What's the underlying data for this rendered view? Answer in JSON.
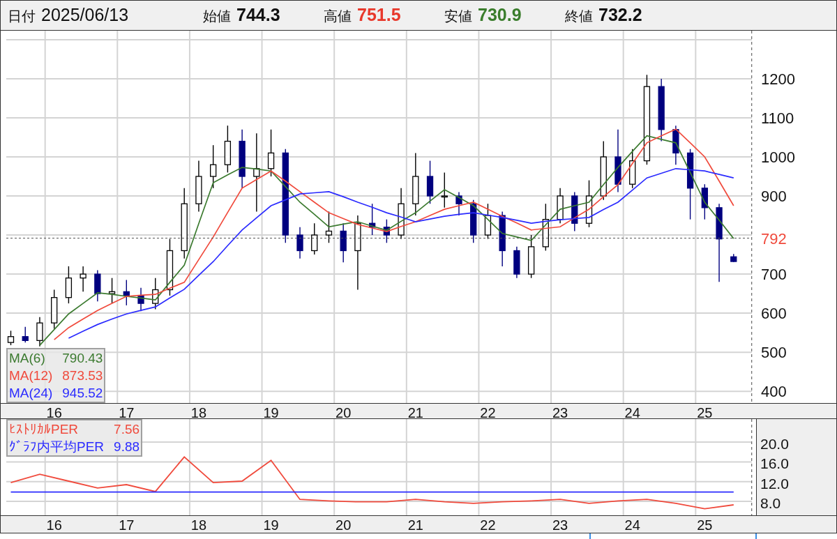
{
  "header": {
    "fields": [
      {
        "label": "日付",
        "value": "2025/06/13",
        "kind": "date"
      },
      {
        "label": "始値",
        "value": "744.3",
        "kind": "open"
      },
      {
        "label": "高値",
        "value": "751.5",
        "kind": "high"
      },
      {
        "label": "安値",
        "value": "730.9",
        "kind": "low"
      },
      {
        "label": "終値",
        "value": "732.2",
        "kind": "close"
      }
    ]
  },
  "price_panel": {
    "legend_readings": [
      "790.43",
      "873.53",
      "945.52"
    ],
    "chart_data": {
      "type": "candlestick",
      "x": [
        15.4,
        15.6,
        15.8,
        16.0,
        16.2,
        16.4,
        16.6,
        16.8,
        17.0,
        17.2,
        17.4,
        17.6,
        17.8,
        18.0,
        18.2,
        18.4,
        18.6,
        18.8,
        19.0,
        19.2,
        19.4,
        19.6,
        19.8,
        20.0,
        20.2,
        20.4,
        20.6,
        20.8,
        21.0,
        21.2,
        21.4,
        21.6,
        21.8,
        22.0,
        22.2,
        22.4,
        22.6,
        22.8,
        23.0,
        23.2,
        23.4,
        23.6,
        23.8,
        24.0,
        24.2,
        24.4,
        24.6,
        24.8,
        25.0,
        25.2,
        25.4
      ],
      "ohlc": [
        [
          525,
          555,
          518,
          540
        ],
        [
          540,
          565,
          525,
          530
        ],
        [
          530,
          590,
          515,
          575
        ],
        [
          575,
          660,
          560,
          640
        ],
        [
          640,
          720,
          625,
          690
        ],
        [
          690,
          720,
          655,
          700
        ],
        [
          700,
          710,
          630,
          650
        ],
        [
          650,
          690,
          625,
          655
        ],
        [
          655,
          685,
          620,
          645
        ],
        [
          645,
          665,
          605,
          625
        ],
        [
          625,
          690,
          610,
          660
        ],
        [
          660,
          790,
          645,
          760
        ],
        [
          760,
          920,
          740,
          880
        ],
        [
          880,
          990,
          860,
          950
        ],
        [
          950,
          1030,
          920,
          980
        ],
        [
          980,
          1080,
          960,
          1040
        ],
        [
          1040,
          1070,
          920,
          950
        ],
        [
          950,
          1060,
          860,
          970
        ],
        [
          970,
          1070,
          950,
          1010
        ],
        [
          1010,
          1020,
          780,
          800
        ],
        [
          800,
          820,
          740,
          760
        ],
        [
          760,
          830,
          750,
          800
        ],
        [
          800,
          860,
          780,
          810
        ],
        [
          810,
          830,
          730,
          760
        ],
        [
          760,
          850,
          660,
          830
        ],
        [
          830,
          880,
          800,
          820
        ],
        [
          820,
          840,
          780,
          800
        ],
        [
          800,
          920,
          790,
          880
        ],
        [
          880,
          1010,
          850,
          950
        ],
        [
          950,
          990,
          880,
          900
        ],
        [
          900,
          960,
          870,
          900
        ],
        [
          900,
          910,
          850,
          880
        ],
        [
          880,
          890,
          780,
          800
        ],
        [
          800,
          880,
          790,
          850
        ],
        [
          850,
          860,
          720,
          760
        ],
        [
          760,
          770,
          690,
          700
        ],
        [
          700,
          800,
          690,
          770
        ],
        [
          770,
          880,
          760,
          840
        ],
        [
          840,
          920,
          830,
          900
        ],
        [
          900,
          910,
          810,
          830
        ],
        [
          830,
          940,
          820,
          900
        ],
        [
          900,
          1040,
          890,
          1000
        ],
        [
          1000,
          1070,
          910,
          930
        ],
        [
          930,
          1020,
          920,
          990
        ],
        [
          990,
          1210,
          980,
          1180
        ],
        [
          1180,
          1200,
          1040,
          1070
        ],
        [
          1070,
          1080,
          980,
          1010
        ],
        [
          1010,
          1020,
          840,
          920
        ],
        [
          920,
          930,
          840,
          870
        ],
        [
          870,
          880,
          680,
          790
        ],
        [
          744.3,
          751.5,
          730.9,
          732.2
        ]
      ],
      "series": [
        {
          "name": "MA(6)",
          "type": "line",
          "color": "#3b7a2f",
          "values": [
            null,
            null,
            518,
            558,
            598,
            625,
            652,
            648,
            643,
            639,
            634,
            679,
            723,
            829,
            934,
            954,
            973,
            969,
            964,
            924,
            884,
            853,
            821,
            828,
            834,
            823,
            812,
            835,
            857,
            887,
            916,
            896,
            875,
            840,
            804,
            795,
            786,
            826,
            866,
            875,
            884,
            929,
            973,
            1014,
            1054,
            1045,
            1036,
            960,
            884,
            838,
            791
          ]
        },
        {
          "name": "MA(12)",
          "type": "line",
          "color": "#f04a3c",
          "values": [
            null,
            null,
            null,
            532,
            563,
            585,
            607,
            625,
            643,
            646,
            648,
            664,
            679,
            737,
            795,
            858,
            920,
            942,
            964,
            938,
            911,
            884,
            857,
            842,
            827,
            818,
            809,
            822,
            834,
            850,
            866,
            875,
            884,
            866,
            848,
            831,
            813,
            817,
            821,
            844,
            866,
            898,
            929,
            983,
            1036,
            1054,
            1071,
            1036,
            1000,
            938,
            875
          ]
        },
        {
          "name": "MA(24)",
          "type": "line",
          "color": "#2b2bff",
          "values": [
            null,
            null,
            null,
            null,
            536,
            554,
            571,
            585,
            598,
            607,
            616,
            639,
            661,
            697,
            732,
            773,
            813,
            844,
            875,
            890,
            905,
            908,
            911,
            898,
            884,
            871,
            857,
            846,
            834,
            841,
            848,
            853,
            857,
            851,
            845,
            838,
            830,
            835,
            839,
            842,
            845,
            865,
            884,
            915,
            946,
            958,
            970,
            967,
            964,
            955,
            946
          ]
        }
      ],
      "xlim": [
        15.26,
        26.84
      ],
      "ylim": [
        370,
        1323
      ],
      "xticks": [
        16,
        17,
        18,
        19,
        20,
        21,
        22,
        23,
        24,
        25
      ],
      "yticks": [
        400,
        500,
        600,
        700,
        900,
        1000,
        1100,
        1200
      ],
      "grid": true,
      "ref_lines": [
        {
          "axis": "y",
          "value": 792,
          "label": "792"
        },
        {
          "axis": "x",
          "value": 25.65
        }
      ]
    }
  },
  "per_panel": {
    "legend_readings": [
      "7.56",
      "9.88"
    ],
    "chart_data": {
      "type": "line",
      "x": [
        15.4,
        15.8,
        16.2,
        16.6,
        17.0,
        17.4,
        17.8,
        18.2,
        18.6,
        19.0,
        19.4,
        19.8,
        20.2,
        20.6,
        21.0,
        21.4,
        21.8,
        22.2,
        22.6,
        23.0,
        23.4,
        23.8,
        24.2,
        24.6,
        25.0,
        25.4
      ],
      "series": [
        {
          "name": "ﾋｽﾄﾘｶﾙPER",
          "color": "#f04a3c",
          "values": [
            11.8,
            13.5,
            12.1,
            10.7,
            11.4,
            10.0,
            17.0,
            11.8,
            12.1,
            16.3,
            8.4,
            8.1,
            7.9,
            7.9,
            8.4,
            7.9,
            7.6,
            7.9,
            8.1,
            8.4,
            7.6,
            8.1,
            8.4,
            7.6,
            6.5,
            7.3
          ]
        },
        {
          "name": "ｸﾞﾗﾌ内平均PER",
          "color": "#2b2bff",
          "values": [
            9.9,
            9.9,
            9.9,
            9.9,
            9.9,
            9.9,
            9.9,
            9.9,
            9.9,
            9.9,
            9.9,
            9.9,
            9.9,
            9.9,
            9.9,
            9.9,
            9.9,
            9.9,
            9.9,
            9.9,
            9.9,
            9.9,
            9.9,
            9.9,
            9.9,
            9.9
          ]
        }
      ],
      "xlim": [
        15.26,
        26.84
      ],
      "ylim": [
        5.18,
        24.67
      ],
      "xticks": [
        16,
        17,
        18,
        19,
        20,
        21,
        22,
        23,
        24,
        25
      ],
      "yticks": [
        {
          "value": 8,
          "label": "8.0"
        },
        {
          "value": 12,
          "label": "12.0"
        },
        {
          "value": 16,
          "label": "16.0"
        },
        {
          "value": 20,
          "label": "20.0"
        }
      ],
      "grid": true,
      "ref_lines": [
        {
          "axis": "x",
          "value": 25.65
        }
      ]
    }
  }
}
